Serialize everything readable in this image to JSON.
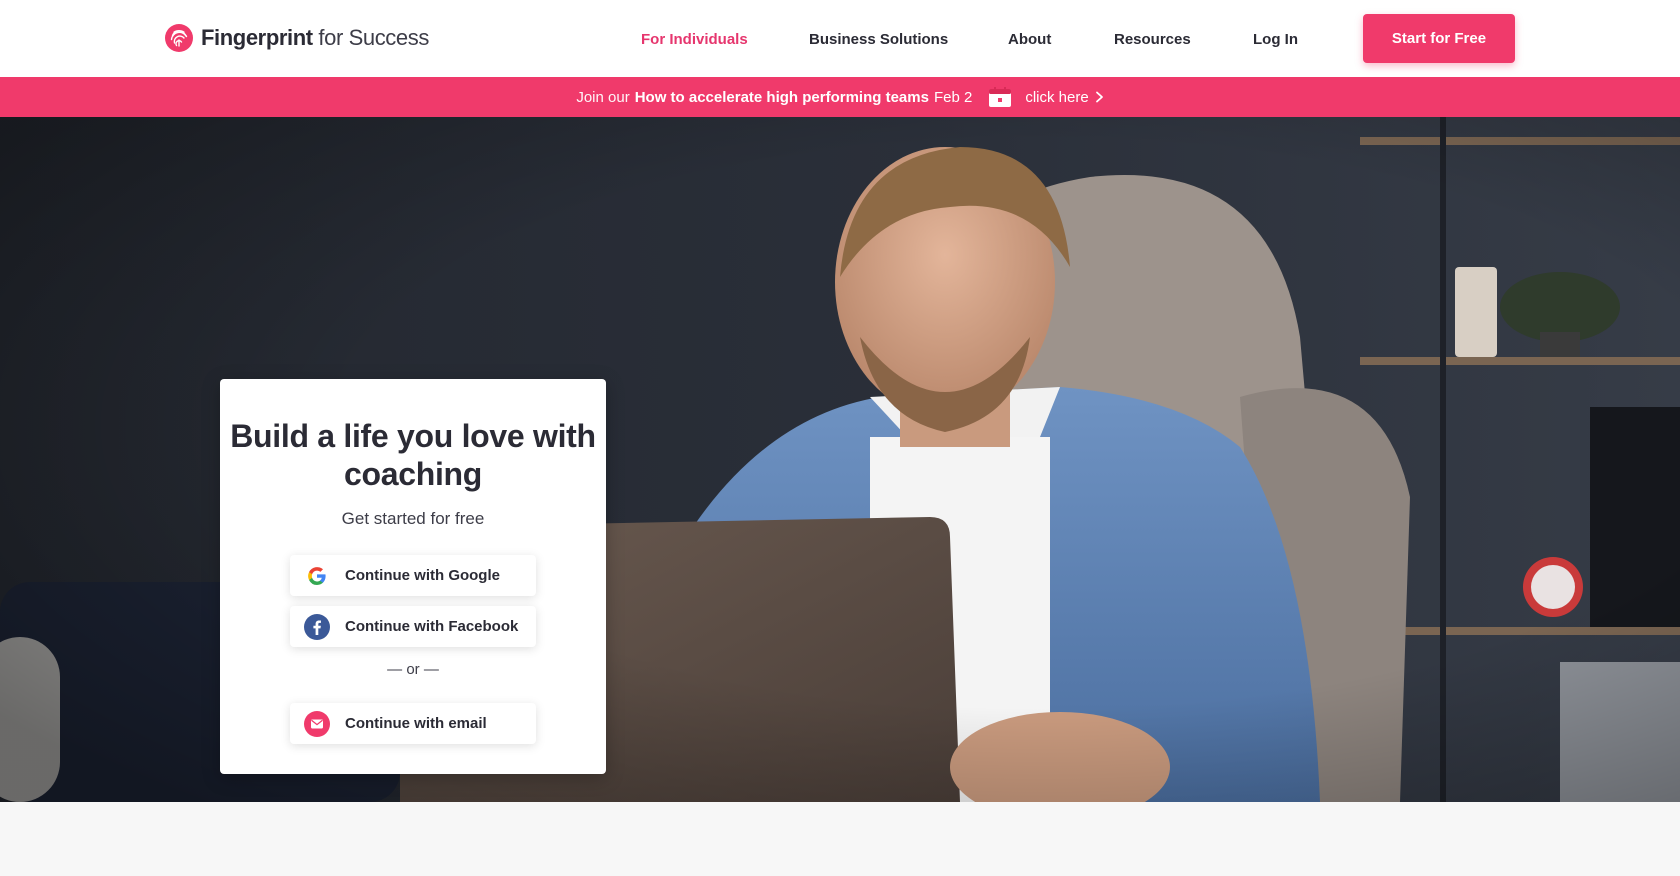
{
  "brand": {
    "name_bold": "Fingerprint",
    "name_light": " for Success",
    "accent_color": "#f03a6b",
    "icon": "fingerprint-icon"
  },
  "nav": {
    "items": [
      {
        "label": "For Individuals",
        "active": true
      },
      {
        "label": "Business Solutions",
        "active": false
      },
      {
        "label": "About",
        "active": false
      },
      {
        "label": "Resources",
        "active": false
      },
      {
        "label": "Log In",
        "active": false
      }
    ],
    "cta_label": "Start for Free"
  },
  "banner": {
    "prefix": "Join our",
    "event_title": "How to accelerate high performing teams",
    "date": "Feb 2",
    "link_label": "click here",
    "icons": [
      "calendar-icon",
      "chevron-right-icon"
    ]
  },
  "hero": {
    "title": "Build a life you love with coaching",
    "subtitle": "Get started for free",
    "buttons": {
      "google": "Continue with Google",
      "facebook": "Continue with Facebook",
      "email": "Continue with email"
    },
    "divider": "— or —",
    "image": "man-working-on-laptop-photo"
  }
}
